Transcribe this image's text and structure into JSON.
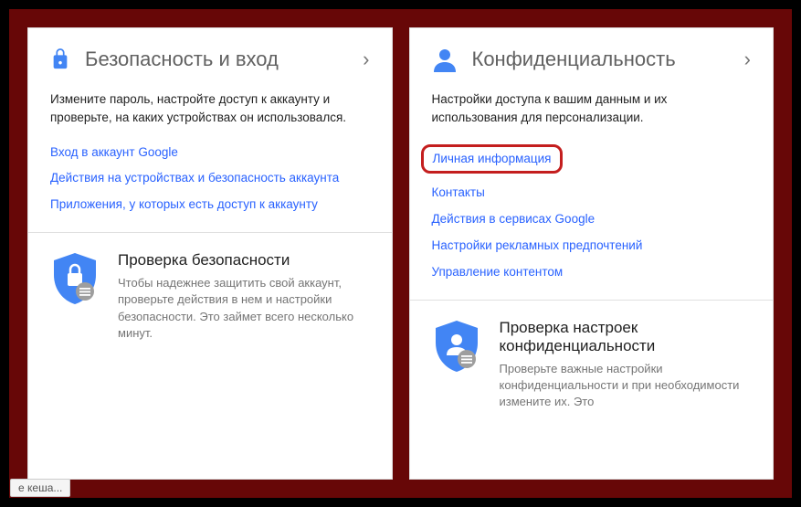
{
  "security": {
    "title": "Безопасность и вход",
    "description": "Измените пароль, настройте доступ к аккаунту и проверьте, на каких устройствах он использовался.",
    "links": [
      "Вход в аккаунт Google",
      "Действия на устройствах и безопасность аккаунта",
      "Приложения, у которых есть доступ к аккаунту"
    ],
    "checkup": {
      "title": "Проверка безопасности",
      "description": "Чтобы надежнее защитить свой аккаунт, проверьте действия в нем и настройки безопасности. Это займет всего несколько минут."
    }
  },
  "privacy": {
    "title": "Конфиденциальность",
    "description": "Настройки доступа к вашим данным и их использования для персонализации.",
    "links": [
      "Личная информация",
      "Контакты",
      "Действия в сервисах Google",
      "Настройки рекламных предпочтений",
      "Управление контентом"
    ],
    "checkup": {
      "title": "Проверка настроек конфиденциальности",
      "description": "Проверьте важные настройки конфиденциальности и при необходимости измените их. Это"
    }
  },
  "statusbar": "е кеша...",
  "colors": {
    "accent_blue": "#4285f4",
    "link_blue": "#2962ff",
    "highlight_red": "#c41e1e"
  }
}
